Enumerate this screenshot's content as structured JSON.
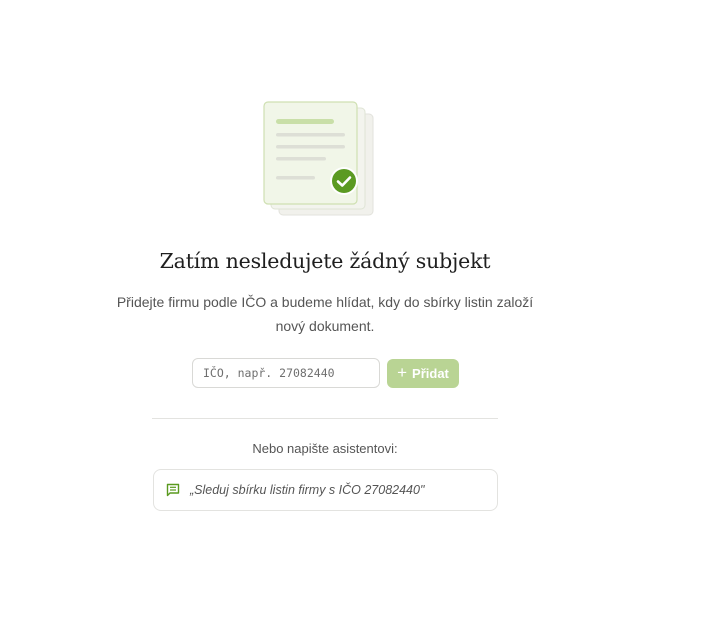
{
  "empty_state": {
    "title": "Zatím nesledujete žádný subjekt",
    "subtitle": "Přidejte firmu podle IČO a budeme hlídat, kdy do sbírky listin založí nový dokument.",
    "illustration_icon": "documents-check-icon"
  },
  "form": {
    "ico_placeholder": "IČO, např. 27082440",
    "ico_value": "",
    "add_label": "Přidat",
    "add_icon": "plus-icon"
  },
  "assistant": {
    "or_label": "Nebo napište asistentovi:",
    "suggestion": "„Sleduj sbírku listin firmy s IČO 27082440\"",
    "suggestion_icon": "chat-icon"
  },
  "colors": {
    "accent": "#5a9a1f",
    "accent_light": "#b9d494",
    "doc_bg": "#f1f4ea",
    "doc_border": "#d2e2b9"
  }
}
